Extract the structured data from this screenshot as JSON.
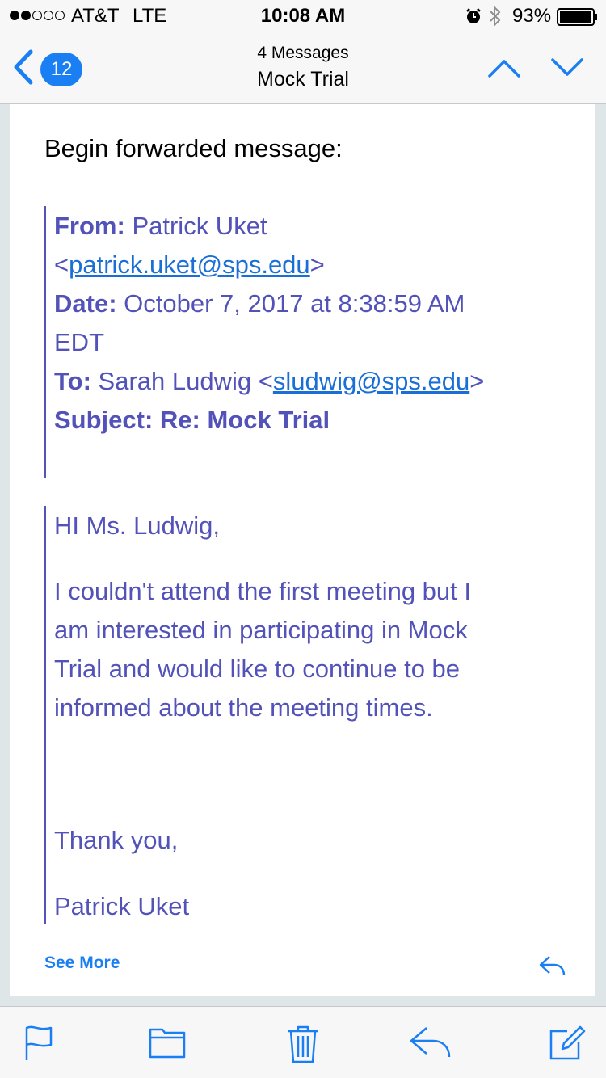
{
  "status_bar": {
    "carrier": "AT&T",
    "network": "LTE",
    "time": "10:08 AM",
    "battery": "93%",
    "signal_bars_filled": 2,
    "signal_bars_total": 5,
    "battery_level": 0.93
  },
  "nav": {
    "back_count": "12",
    "subtitle": "4 Messages",
    "title": "Mock Trial",
    "icons": {
      "back": "chevron-left-icon",
      "prev": "chevron-up-icon",
      "next": "chevron-down-icon"
    }
  },
  "message": {
    "forward_header": "Begin forwarded message:",
    "header": {
      "from_label": "From:",
      "from_name": "Patrick Uket",
      "from_email": "patrick.uket@sps.edu",
      "date_label": "Date:",
      "date_value_line1": "October 7, 2017 at 8:38:59 AM",
      "date_value_line2": "EDT",
      "to_label": "To:",
      "to_name": "Sarah Ludwig",
      "to_email": "sludwig@sps.edu",
      "subject_label": "Subject:",
      "subject_value": "Re: Mock Trial"
    },
    "body": {
      "greeting": "HI Ms. Ludwig,",
      "lines": [
        "I couldn't attend the first meeting but I",
        "am interested in participating in Mock",
        "Trial and would like to continue to be",
        "informed about the meeting times."
      ],
      "closing": "Thank you,",
      "signature": "Patrick Uket"
    },
    "see_more": "See More"
  },
  "toolbar": {
    "icons": [
      "flag-icon",
      "folder-icon",
      "trash-icon",
      "reply-icon",
      "compose-icon"
    ]
  },
  "colors": {
    "accent": "#1a7ff2",
    "quote_text": "#5252b8",
    "link": "#1a6fd6"
  }
}
